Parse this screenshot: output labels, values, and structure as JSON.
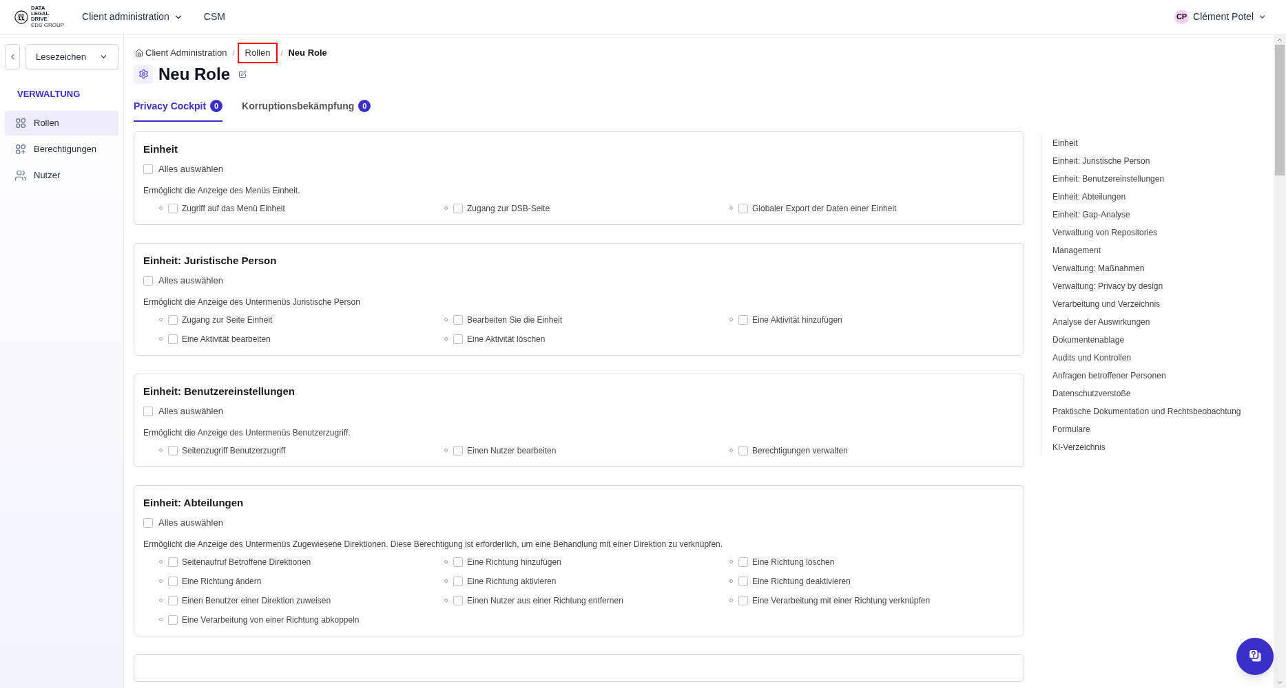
{
  "topbar": {
    "logo_lines": [
      "DATA",
      "LEGAL",
      "DRIVE"
    ],
    "logo_sub": "EDS GROUP",
    "nav": [
      {
        "label": "Client administration",
        "dropdown": true
      },
      {
        "label": "CSM",
        "dropdown": false
      }
    ],
    "user": {
      "initials": "CP",
      "name": "Clément Potel"
    }
  },
  "sidebar": {
    "bookmarks": "Lesezeichen",
    "section": "VERWALTUNG",
    "items": [
      {
        "label": "Rollen",
        "selected": true
      },
      {
        "label": "Berechtigungen",
        "selected": false
      },
      {
        "label": "Nutzer",
        "selected": false
      }
    ]
  },
  "breadcrumb_separator": "/",
  "breadcrumb": [
    {
      "label": "Client Administration",
      "highlighted": false
    },
    {
      "label": "Rollen",
      "highlighted": true
    },
    {
      "label": "Neu Role",
      "highlighted": false
    }
  ],
  "title": "Neu Role",
  "tabs": [
    {
      "label": "Privacy Cockpit",
      "count": "0",
      "selected": true
    },
    {
      "label": "Korruptionsbekämpfung",
      "count": "0",
      "selected": false
    }
  ],
  "sections": [
    {
      "title": "Einheit",
      "select_all": {
        "label": "Alles auswählen",
        "checked": false
      },
      "description": "Ermöglicht die Anzeige des Menüs Einheit.",
      "permissions": [
        {
          "label": "Zugriff auf das Menü Einheit",
          "checked": false
        },
        {
          "label": "Zugang zur DSB-Seite",
          "checked": false
        },
        {
          "label": "Globaler Export der Daten einer Einheit",
          "checked": false
        }
      ]
    },
    {
      "title": "Einheit: Juristische Person",
      "select_all": {
        "label": "Alles auswählen",
        "checked": false
      },
      "description": "Ermöglicht die Anzeige des Untermenüs Juristische Person",
      "permissions": [
        {
          "label": "Zugang zur Seite Einheit",
          "checked": false
        },
        {
          "label": "Bearbeiten Sie die Einheit",
          "checked": false
        },
        {
          "label": "Eine Aktivität hinzufügen",
          "checked": false
        },
        {
          "label": "Eine Aktivität bearbeiten",
          "checked": false
        },
        {
          "label": "Eine Aktivität löschen",
          "checked": false
        }
      ]
    },
    {
      "title": "Einheit: Benutzereinstellungen",
      "select_all": {
        "label": "Alles auswählen",
        "checked": false
      },
      "description": "Ermöglicht die Anzeige des Untermenüs Benutzerzugriff.",
      "permissions": [
        {
          "label": "Seitenzugriff Benutzerzugriff",
          "checked": false
        },
        {
          "label": "Einen Nutzer bearbeiten",
          "checked": false
        },
        {
          "label": "Berechtigungen verwalten",
          "checked": false
        }
      ]
    },
    {
      "title": "Einheit: Abteilungen",
      "select_all": {
        "label": "Alles auswählen",
        "checked": false
      },
      "description": "Ermöglicht die Anzeige des Untermenüs Zugewiesene Direktionen. Diese Berechtigung ist erforderlich, um eine Behandlung mit einer Direktion zu verknüpfen.",
      "permissions": [
        {
          "label": "Seitenaufruf Betroffene Direktionen",
          "checked": false
        },
        {
          "label": "Eine Richtung hinzufügen",
          "checked": false
        },
        {
          "label": "Eine Richtung löschen",
          "checked": false
        },
        {
          "label": "Eine Richtung ändern",
          "checked": false
        },
        {
          "label": "Eine Richtung aktivieren",
          "checked": false
        },
        {
          "label": "Eine Richtung deaktivieren",
          "checked": false
        },
        {
          "label": "Einen Benutzer einer Direktion zuweisen",
          "checked": false
        },
        {
          "label": "Einen Nutzer aus einer Richtung entfernen",
          "checked": false
        },
        {
          "label": "Eine Verarbeitung mit einer Richtung verknüpfen",
          "checked": false
        },
        {
          "label": "Eine Verarbeitung von einer Richtung abkoppeln",
          "checked": false
        }
      ]
    }
  ],
  "toc": [
    "Einheit",
    "Einheit: Juristische Person",
    "Einheit: Benutzereinstellungen",
    "Einheit: Abteilungen",
    "Einheit: Gap-Analyse",
    "Verwaltung von Repositories",
    "Management",
    "Verwaltung: Maßnahmen",
    "Verwaltung: Privacy by design",
    "Verarbeitung und Verzeichnis",
    "Analyse der Auswirkungen",
    "Dokumentenablage",
    "Audits und Kontrollen",
    "Anfragen betroffener Personen",
    "Datenschutzverstoße",
    "Praktische Dokumentation und Rechtsbeobachtung",
    "Formulare",
    "KI-Verzeichnis"
  ]
}
